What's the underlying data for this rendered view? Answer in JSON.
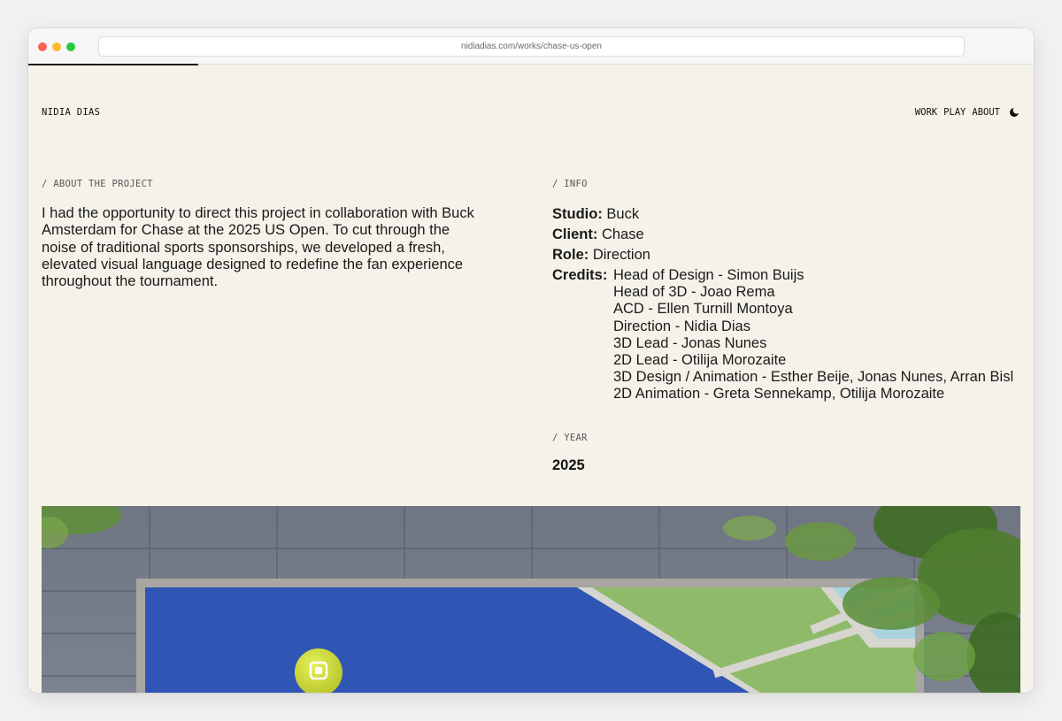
{
  "browser": {
    "url": "nidiadias.com/works/chase-us-open"
  },
  "header": {
    "brand": "NIDIA DIAS",
    "nav": [
      "WORK",
      "PLAY",
      "ABOUT"
    ],
    "theme_icon": "moon-icon"
  },
  "about": {
    "label": "/ ABOUT THE PROJECT",
    "lines": [
      "I had the opportunity to direct this project in collaboration with Buck",
      "Amsterdam for Chase at the 2025 US Open. To cut through the",
      "noise of traditional sports sponsorships, we developed a fresh,",
      "elevated visual language designed to redefine the fan experience",
      "throughout the tournament."
    ]
  },
  "info": {
    "label": "/ INFO",
    "studio_key": "Studio:",
    "studio": "Buck",
    "client_key": "Client:",
    "client": "Chase",
    "role_key": "Role:",
    "role": "Direction",
    "credits_key": "Credits:",
    "credits": [
      "Head of Design - Simon  Buijs",
      "Head of 3D - Joao Rema",
      "ACD - Ellen Turnill Montoya",
      "Direction - Nidia Dias",
      "3D Lead - Jonas Nunes",
      "2D Lead - Otilija Morozaite",
      "3D Design / Animation - Esther Beije, Jonas Nunes, Arran Bisl",
      "2D Animation - Greta Sennekamp, Otilija Morozaite"
    ]
  },
  "year": {
    "label": "/ YEAR",
    "value": "2025"
  },
  "colors": {
    "page_bg": "#f5f2ea",
    "court_blue": "#2f55b5",
    "court_green": "#8fba6a",
    "court_light": "#a9d3df",
    "wall": "#707683",
    "ball": "#d4e03a"
  }
}
